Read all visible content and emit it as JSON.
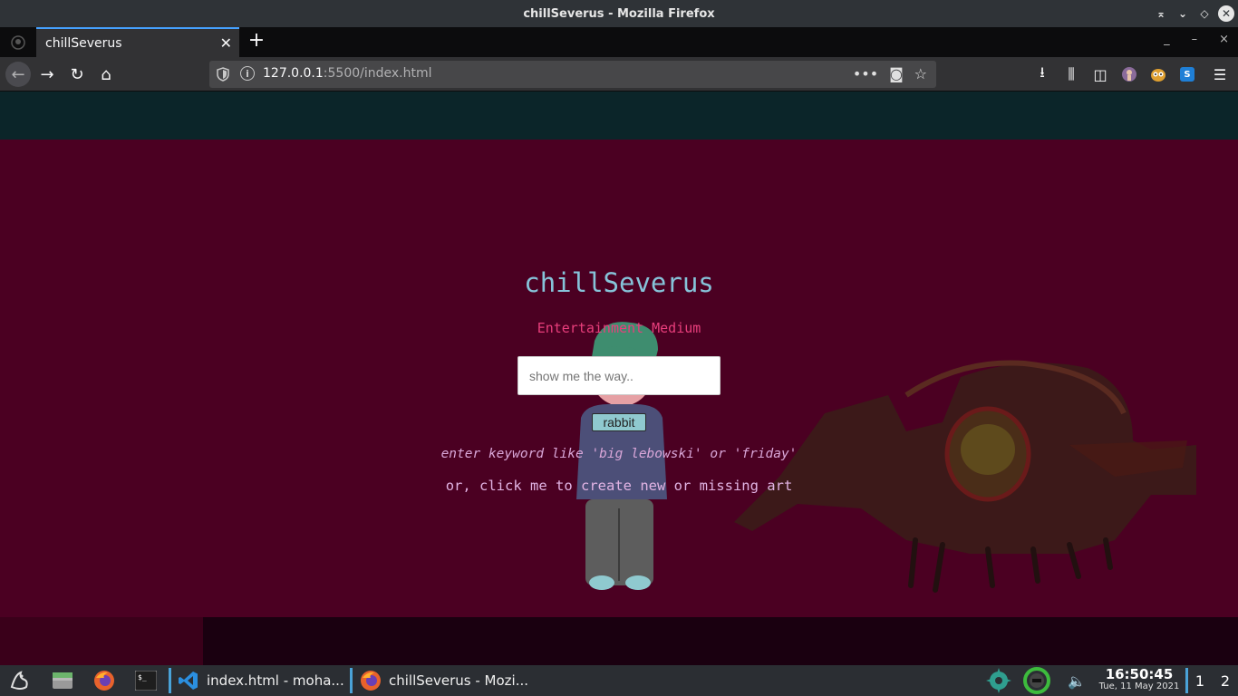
{
  "window": {
    "title": "chillSeverus - Mozilla Firefox",
    "controls": [
      "⌅",
      "⌄",
      "◇",
      "✕"
    ]
  },
  "tabs": {
    "active_tab_label": "chillSeverus",
    "close_glyph": "✕",
    "new_tab_glyph": "+",
    "window_buttons": [
      "_",
      "–",
      "×"
    ]
  },
  "toolbar": {
    "back": "←",
    "forward": "→",
    "reload": "↻",
    "home": "⌂",
    "info": "i",
    "url_host": "127.0.0.1",
    "url_rest": ":5500/index.html",
    "page_actions": "•••",
    "pocket": "◙",
    "bookmark": "☆",
    "download": "⭳",
    "library": "⫼",
    "sidebar": "◫",
    "menu": "☰",
    "ext_s_label": "S",
    "colors": {
      "ext_s": "#1f7fd6",
      "ext_avatar": "#8a6b9a",
      "ext_owl": "#e0a030"
    }
  },
  "page": {
    "title": "chillSeverus",
    "subtitle": "Entertainment Medium",
    "search_placeholder": "show me the way..",
    "search_value": "",
    "rabbit_button": "rabbit",
    "hint": "enter keyword like 'big lebowski' or 'friday'",
    "create_link": "or, click me to create new or missing art",
    "colors": {
      "background": "#4b0022",
      "header": "#0b2529",
      "title": "#86c3d9",
      "subtitle": "#e83e7c",
      "button": "#8fc9cf"
    }
  },
  "taskbar": {
    "tasks": [
      {
        "label": "index.html - moha...",
        "icon": "vscode-icon"
      },
      {
        "label": "chillSeverus - Mozi...",
        "icon": "firefox-icon"
      }
    ],
    "clock_time": "16:50:45",
    "clock_date": "Tue, 11 May 2021",
    "workspaces": [
      "1",
      "2"
    ],
    "volume_glyph": "🔈"
  }
}
